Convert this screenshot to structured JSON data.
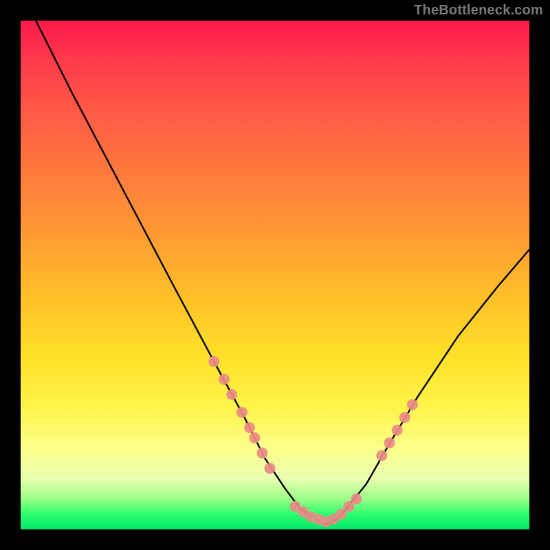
{
  "watermark": "TheBottleneck.com",
  "chart_data": {
    "type": "line",
    "title": "",
    "xlabel": "",
    "ylabel": "",
    "xlim": [
      0,
      100
    ],
    "ylim": [
      0,
      100
    ],
    "grid": false,
    "legend": false,
    "series": [
      {
        "name": "curve",
        "color": "#000000",
        "x": [
          3,
          10,
          20,
          30,
          38,
          44,
          48,
          52,
          55,
          58,
          60,
          62,
          64,
          68,
          72,
          78,
          86,
          94,
          100
        ],
        "y": [
          100,
          86,
          67,
          48,
          33,
          22,
          14,
          8,
          4,
          2,
          1,
          2,
          4,
          9,
          16,
          26,
          38,
          48,
          55
        ]
      }
    ],
    "markers": [
      {
        "name": "left-cluster",
        "color": "#e98b87",
        "points": [
          {
            "x": 38.0,
            "y": 33.0
          },
          {
            "x": 40.0,
            "y": 29.5
          },
          {
            "x": 41.5,
            "y": 26.5
          },
          {
            "x": 43.5,
            "y": 23.0
          },
          {
            "x": 45.0,
            "y": 20.0
          },
          {
            "x": 46.0,
            "y": 18.0
          },
          {
            "x": 47.5,
            "y": 15.0
          },
          {
            "x": 49.0,
            "y": 12.0
          }
        ]
      },
      {
        "name": "bottom-cluster",
        "color": "#e98b87",
        "points": [
          {
            "x": 54.0,
            "y": 4.5
          },
          {
            "x": 55.5,
            "y": 3.5
          },
          {
            "x": 57.0,
            "y": 2.5
          },
          {
            "x": 58.5,
            "y": 2.0
          },
          {
            "x": 60.0,
            "y": 1.5
          },
          {
            "x": 61.5,
            "y": 2.0
          },
          {
            "x": 63.0,
            "y": 3.0
          },
          {
            "x": 64.5,
            "y": 4.5
          },
          {
            "x": 66.0,
            "y": 6.0
          }
        ]
      },
      {
        "name": "right-cluster",
        "color": "#e98b87",
        "points": [
          {
            "x": 71.0,
            "y": 14.5
          },
          {
            "x": 72.5,
            "y": 17.0
          },
          {
            "x": 74.0,
            "y": 19.5
          },
          {
            "x": 75.5,
            "y": 22.0
          },
          {
            "x": 77.0,
            "y": 24.5
          }
        ]
      }
    ]
  }
}
